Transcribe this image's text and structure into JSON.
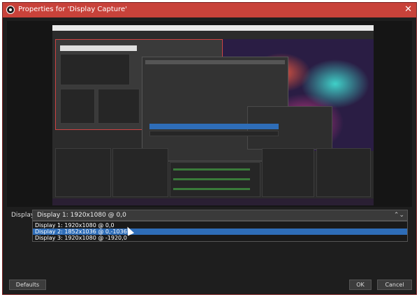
{
  "window": {
    "title": "Properties for 'Display Capture'",
    "close_glyph": "✕"
  },
  "display": {
    "label": "Display",
    "selected": "Display 1: 1920x1080 @ 0,0",
    "arrows_glyph": "⌃⌄",
    "options": [
      "Display 1: 1920x1080 @ 0,0",
      "Display 2: 1852x1036 @ 0,-1036",
      "Display 3: 1920x1080 @ -1920,0"
    ],
    "highlighted_index": 1
  },
  "buttons": {
    "defaults": "Defaults",
    "ok": "OK",
    "cancel": "Cancel"
  },
  "colors": {
    "titlebar": "#c8423a",
    "selection": "#2e6db8"
  },
  "icons": {
    "app": "obs-logo-icon",
    "close": "close-icon",
    "cursor": "mouse-pointer-icon"
  }
}
